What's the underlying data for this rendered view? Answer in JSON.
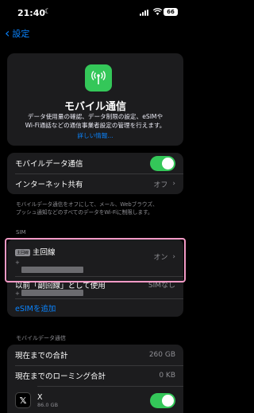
{
  "status": {
    "time": "21:40",
    "battery": "66"
  },
  "nav": {
    "back_label": "設定"
  },
  "hero": {
    "title": "モバイル通信",
    "desc_line1": "データ使用量の確認、データ制限の設定、eSIMや",
    "desc_line2": "Wi-Fi通話などの通信事業者設定の管理を行えます。",
    "link": "詳しい情報..."
  },
  "settings": {
    "mobile_data": "モバイルデータ通信",
    "hotspot": "インターネット共有",
    "hotspot_value": "オフ"
  },
  "note": {
    "line1": "モバイルデータ通信をオフにして、メール、Webブラウズ、",
    "line2": "プッシュ通知などのすべてのデータをWi-Fiに制限します。"
  },
  "sim": {
    "section": "SIM",
    "badge": "主回線",
    "primary_name": "主回線",
    "primary_value": "オン",
    "primary_sub": "+",
    "secondary_name": "以前「副回線」として使用",
    "secondary_value": "SIMなし",
    "secondary_sub": "+",
    "add_esim": "eSIMを追加"
  },
  "usage": {
    "section": "モバイルデータ通信",
    "total_label": "現在までの合計",
    "total_value": "260 GB",
    "roaming_label": "現在までのローミング合計",
    "roaming_value": "0 KB"
  },
  "apps": [
    {
      "name": "X",
      "size": "86.0 GB",
      "icon": "x-logo-icon"
    }
  ],
  "colors": {
    "accent": "#0a84ff",
    "toggle_on": "#34c759",
    "highlight": "#f49ac6"
  }
}
